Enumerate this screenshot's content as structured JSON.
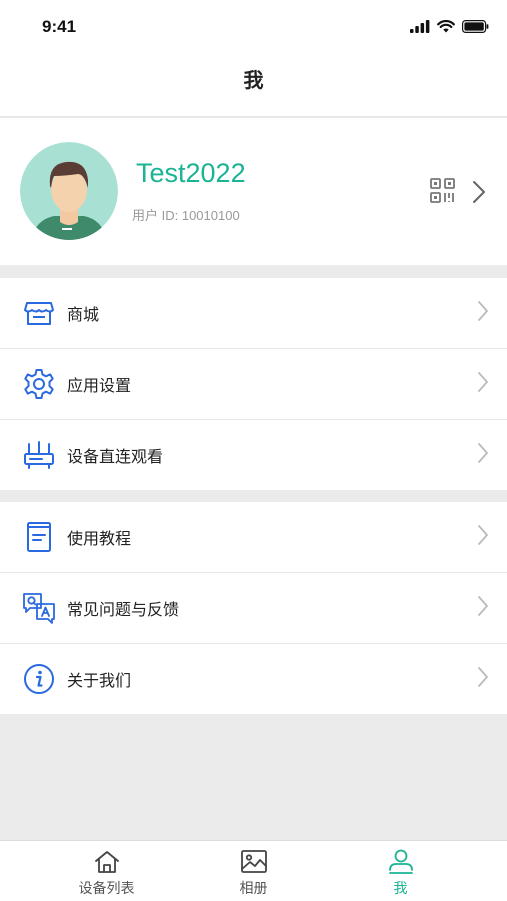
{
  "status_bar": {
    "time": "9:41"
  },
  "nav": {
    "title": "我"
  },
  "profile": {
    "username": "Test2022",
    "user_id": "用户 ID: 10010100"
  },
  "menu_group_1": [
    {
      "label": "商城",
      "icon": "store-icon"
    },
    {
      "label": "应用设置",
      "icon": "gear-icon"
    },
    {
      "label": "设备直连观看",
      "icon": "router-icon"
    }
  ],
  "menu_group_2": [
    {
      "label": "使用教程",
      "icon": "book-icon"
    },
    {
      "label": "常见问题与反馈",
      "icon": "qa-icon"
    },
    {
      "label": "关于我们",
      "icon": "info-icon"
    }
  ],
  "tabs": [
    {
      "label": "设备列表",
      "icon": "home-icon",
      "active": false
    },
    {
      "label": "相册",
      "icon": "image-icon",
      "active": false
    },
    {
      "label": "我",
      "icon": "person-icon",
      "active": true
    }
  ],
  "colors": {
    "accent": "#1ab394",
    "icon_blue": "#2a6ae0"
  }
}
